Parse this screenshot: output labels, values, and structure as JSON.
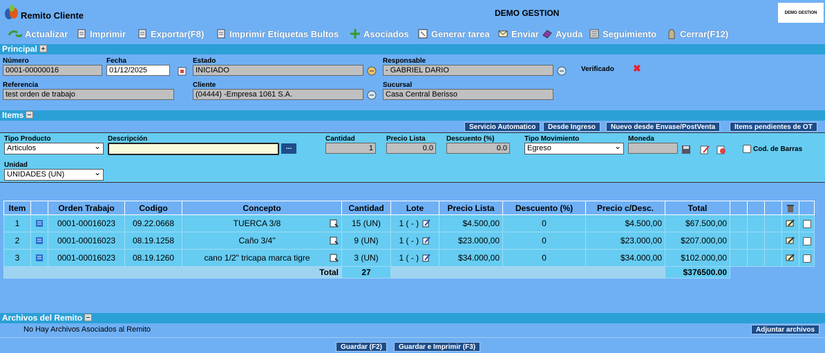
{
  "window": {
    "title": "Remito Cliente",
    "company": "DEMO GESTION",
    "brand_box": "DEMO GESTION"
  },
  "toolbar": [
    {
      "label": "Actualizar",
      "icon": "refresh-icon"
    },
    {
      "label": "Imprimir",
      "icon": "print-icon"
    },
    {
      "label": "Exportar(F8)",
      "icon": "export-icon"
    },
    {
      "label": "Imprimir Etiquetas Bultos",
      "icon": "label-print-icon"
    },
    {
      "label": "Asociados",
      "icon": "associates-icon"
    },
    {
      "label": "Generar tarea",
      "icon": "task-icon"
    },
    {
      "label": "Enviar",
      "icon": "send-icon"
    },
    {
      "label": "Ayuda",
      "icon": "help-icon"
    },
    {
      "label": "Seguimiento",
      "icon": "tracking-icon"
    },
    {
      "label": "Cerrar(F12)",
      "icon": "close-window-icon"
    }
  ],
  "principal": {
    "section_title": "Principal",
    "numero_label": "Número",
    "numero": "0001-00000016",
    "fecha_label": "Fecha",
    "fecha": "01/12/2025",
    "estado_label": "Estado",
    "estado": "INICIADO",
    "responsable_label": "Responsable",
    "responsable": "- GABRIEL DARIO",
    "verificado_label": "Verificado",
    "referencia_label": "Referencia",
    "referencia": "test orden de trabajo",
    "cliente_label": "Cliente",
    "cliente": "(04444) -Empresa 1061 S.A.",
    "sucursal_label": "Sucursal",
    "sucursal": "Casa Central Berisso"
  },
  "items": {
    "section_title": "Items",
    "buttons": [
      "Servicio Automatico",
      "Desde Ingreso",
      "Nuevo desde Envase/PostVenta",
      "Items pendientes de OT"
    ],
    "tipo_producto_label": "Tipo Producto",
    "tipo_producto": "Articulos",
    "descripcion_label": "Descripción",
    "descripcion": "",
    "descripcion_btn": "...",
    "cantidad_label": "Cantidad",
    "cantidad": "1",
    "precio_lista_label": "Precio Lista",
    "precio_lista": "0.0",
    "descuento_label": "Descuento (%)",
    "descuento": "0.0",
    "tipo_mov_label": "Tipo Movimiento",
    "tipo_mov": "Egreso",
    "moneda_label": "Moneda",
    "moneda": "",
    "cod_barras_label": "Cod. de Barras",
    "unidad_label": "Unidad",
    "unidad": "UNIDADES (UN)"
  },
  "grid": {
    "headers": {
      "item": "Item",
      "orden": "Orden Trabajo",
      "codigo": "Codigo",
      "concepto": "Concepto",
      "cantidad": "Cantidad",
      "lote": "Lote",
      "precio_lista": "Precio Lista",
      "descuento": "Descuento (%)",
      "precio_desc": "Precio c/Desc.",
      "total": "Total"
    },
    "rows": [
      {
        "item": "1",
        "orden": "0001-00016023",
        "codigo": "09.22.0668",
        "concepto": "TUERCA 3/8",
        "cantidad": "15 (UN)",
        "lote": "1 ( - )",
        "precio_lista": "$4.500,00",
        "descuento": "0",
        "precio_desc": "$4.500,00",
        "total": "$67.500,00"
      },
      {
        "item": "2",
        "orden": "0001-00016023",
        "codigo": "08.19.1258",
        "concepto": "Caño 3/4\"",
        "cantidad": "9 (UN)",
        "lote": "1 ( - )",
        "precio_lista": "$23.000,00",
        "descuento": "0",
        "precio_desc": "$23.000,00",
        "total": "$207.000,00"
      },
      {
        "item": "3",
        "orden": "0001-00016023",
        "codigo": "08.19.1260",
        "concepto": "cano 1/2\" tricapa marca tigre",
        "cantidad": "3 (UN)",
        "lote": "1 ( - )",
        "precio_lista": "$34.000,00",
        "descuento": "0",
        "precio_desc": "$34.000,00",
        "total": "$102.000,00"
      }
    ],
    "total_label": "Total",
    "total_cantidad": "27",
    "total_importe": "$376500.00"
  },
  "archivos": {
    "section_title": "Archivos del Remito",
    "empty_text": "No Hay Archivos Asociados al Remito",
    "adjuntar": "Adjuntar archivos"
  },
  "footer": {
    "guardar": "Guardar (F2)",
    "guardar_imprimir": "Guardar e Imprimir (F3)"
  }
}
